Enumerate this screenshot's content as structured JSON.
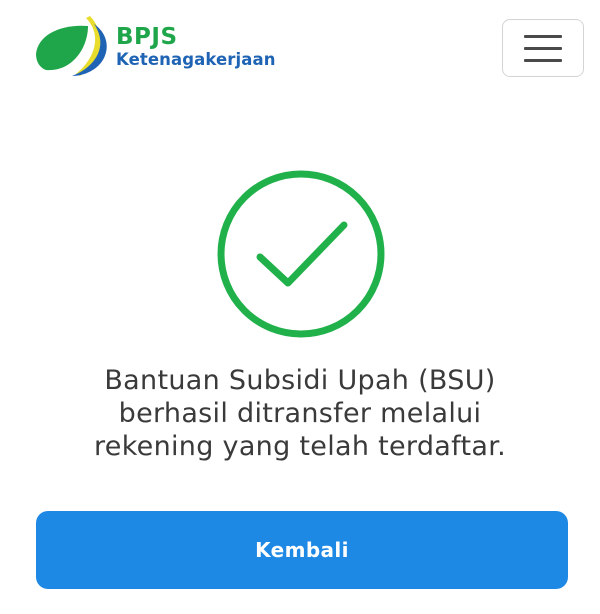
{
  "colors": {
    "brand_green": "#1fa64a",
    "brand_blue": "#1f63b5",
    "brand_yellow": "#e8dc2c",
    "accent": "#1e88e5",
    "success": "#21b14b"
  },
  "header": {
    "logo": {
      "title": "BPJS",
      "subtitle": "Ketenagakerjaan",
      "icon": "bpjs-leaf-logo"
    },
    "menu_button": {
      "icon": "hamburger-icon"
    }
  },
  "status": {
    "icon": "check-circle-icon",
    "message_lines": [
      "Bantuan Subsidi Upah (BSU)",
      "berhasil ditransfer melalui",
      "rekening yang telah terdaftar."
    ]
  },
  "actions": {
    "back_label": "Kembali"
  }
}
